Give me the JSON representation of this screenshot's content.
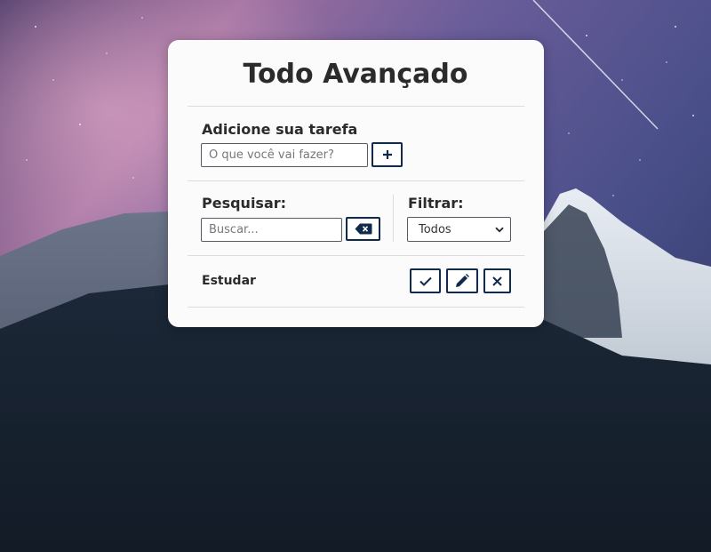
{
  "app": {
    "title": "Todo Avançado"
  },
  "add_form": {
    "label": "Adicione sua tarefa",
    "placeholder": "O que você vai fazer?",
    "value": "",
    "submit_icon": "plus-icon"
  },
  "search": {
    "label": "Pesquisar:",
    "placeholder": "Buscar...",
    "value": "",
    "clear_icon": "backspace-icon"
  },
  "filter": {
    "label": "Filtrar:",
    "selected": "Todos",
    "icon": "chevron-down-icon"
  },
  "todos": [
    {
      "title": "Estudar",
      "actions": [
        "check-icon",
        "pencil-icon",
        "close-icon"
      ]
    }
  ],
  "colors": {
    "accent": "#102a4c",
    "card": "#fbfbfb",
    "text": "#2b2b2b"
  }
}
